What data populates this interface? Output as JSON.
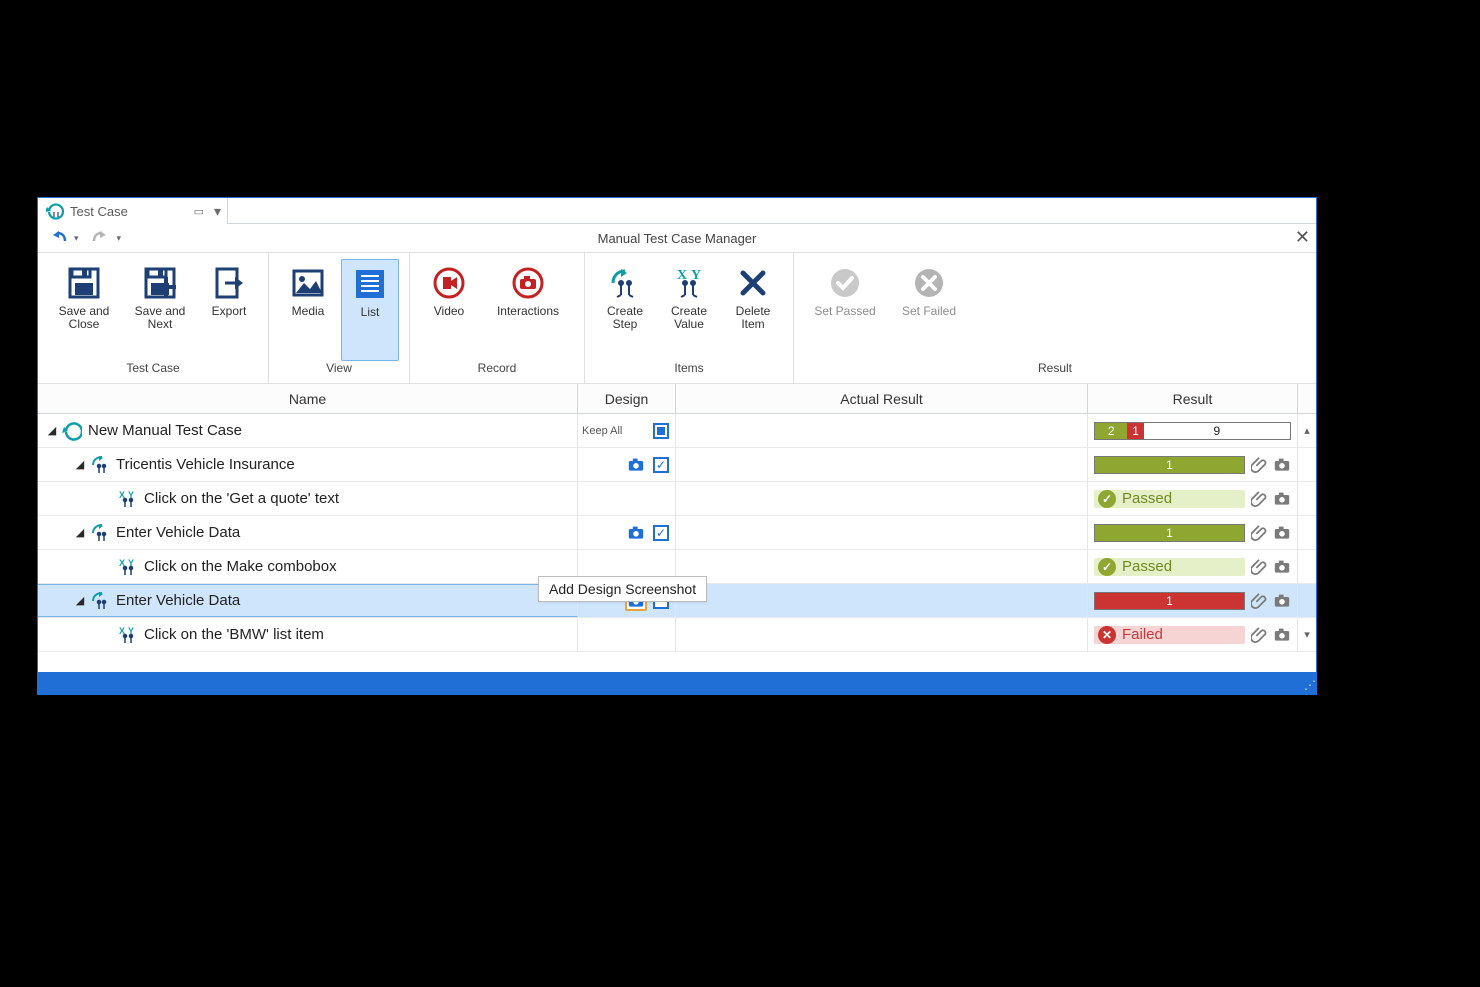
{
  "tab": {
    "label": "Test Case"
  },
  "header": {
    "title": "Manual Test Case Manager"
  },
  "ribbon": {
    "groups": {
      "testcase": {
        "label": "Test Case",
        "save_close": "Save and\nClose",
        "save_next": "Save and\nNext",
        "export": "Export"
      },
      "view": {
        "label": "View",
        "media": "Media",
        "list": "List"
      },
      "record": {
        "label": "Record",
        "video": "Video",
        "interactions": "Interactions"
      },
      "items": {
        "label": "Items",
        "create_step": "Create\nStep",
        "create_value": "Create\nValue",
        "delete_item": "Delete\nItem"
      },
      "result": {
        "label": "Result",
        "set_passed": "Set Passed",
        "set_failed": "Set Failed"
      }
    }
  },
  "columns": {
    "name": "Name",
    "design": "Design",
    "actual": "Actual Result",
    "result": "Result"
  },
  "rows": [
    {
      "indent": 0,
      "expanded": true,
      "icon": "refresh",
      "title": "New Manual Test Case",
      "design": {
        "keepall": "Keep All",
        "square": true
      },
      "result": {
        "type": "bar",
        "segments": [
          {
            "n": 2,
            "c": "g"
          },
          {
            "n": 1,
            "c": "r"
          },
          {
            "n": 9,
            "c": "w"
          }
        ]
      }
    },
    {
      "indent": 1,
      "expanded": true,
      "icon": "step",
      "title": "Tricentis Vehicle Insurance",
      "design": {
        "camera": true,
        "checked": true
      },
      "result": {
        "type": "bar",
        "segments": [
          {
            "n": 1,
            "c": "g",
            "full": true
          }
        ],
        "attach": true
      }
    },
    {
      "indent": 2,
      "expanded": null,
      "icon": "value",
      "title": "Click on the 'Get a quote' text",
      "design": {},
      "result": {
        "type": "status",
        "status": "pass",
        "label": "Passed",
        "attach": true
      }
    },
    {
      "indent": 1,
      "expanded": true,
      "icon": "step",
      "title": "Enter Vehicle Data",
      "design": {
        "camera": true,
        "checked": true
      },
      "result": {
        "type": "bar",
        "segments": [
          {
            "n": 1,
            "c": "g",
            "full": true
          }
        ],
        "attach": true
      }
    },
    {
      "indent": 2,
      "expanded": null,
      "icon": "value",
      "title": "Click on the Make combobox",
      "design": {},
      "result": {
        "type": "status",
        "status": "pass",
        "label": "Passed",
        "attach": true
      }
    },
    {
      "indent": 1,
      "expanded": true,
      "icon": "step",
      "title": "Enter Vehicle Data",
      "selected": true,
      "design": {
        "camera": true,
        "camera_highlight": true,
        "checked": false,
        "checkbox": true
      },
      "result": {
        "type": "bar",
        "segments": [
          {
            "n": 1,
            "c": "r",
            "full": true
          }
        ],
        "attach": true
      }
    },
    {
      "indent": 2,
      "expanded": null,
      "icon": "value",
      "title": "Click on the 'BMW' list item",
      "design": {},
      "result": {
        "type": "status",
        "status": "fail",
        "label": "Failed",
        "attach": true
      }
    }
  ],
  "tooltip": "Add Design Screenshot"
}
